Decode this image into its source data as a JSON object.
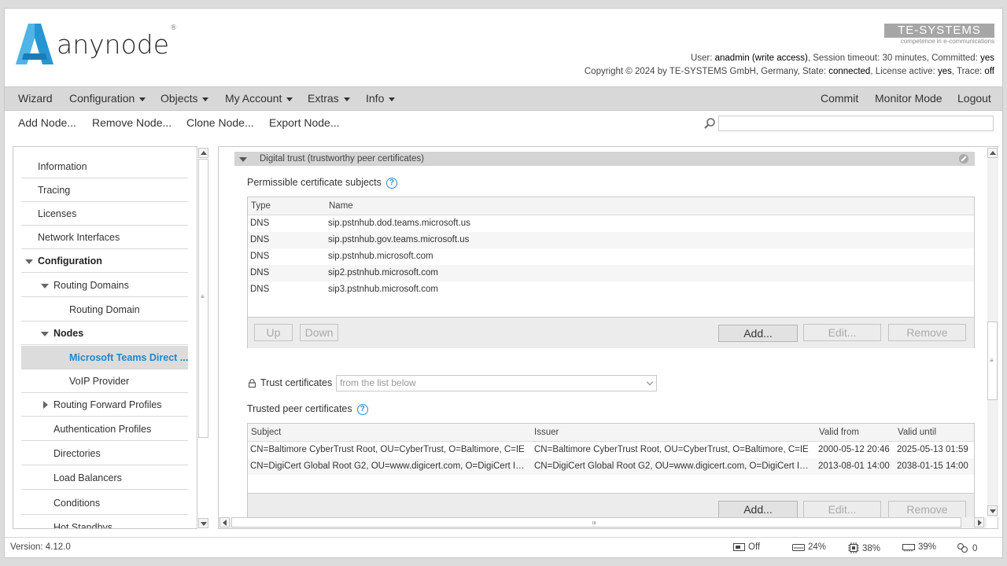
{
  "header": {
    "logo_text": "anynode",
    "logo_reg": "®",
    "brand_name": "TE-SYSTEMS",
    "brand_tagline": "competence in e-communications",
    "info_line1": {
      "user_label": "User: ",
      "user": "anadmin",
      "access": " (write access)",
      "session": ", Session timeout: 30 minutes, Committed: ",
      "committed": "yes"
    },
    "info_line2": {
      "copyright": "Copyright © 2024 by TE-SYSTEMS GmbH, Germany, State: ",
      "state": "connected",
      "license": ", License active: ",
      "license_val": "yes",
      "trace": ", Trace: ",
      "trace_val": "off"
    }
  },
  "menu": {
    "left": [
      {
        "label": "Wizard",
        "dropdown": false
      },
      {
        "label": "Configuration",
        "dropdown": true
      },
      {
        "label": "Objects",
        "dropdown": true
      },
      {
        "label": "My Account",
        "dropdown": true
      },
      {
        "label": "Extras",
        "dropdown": true
      },
      {
        "label": "Info",
        "dropdown": true
      }
    ],
    "right": [
      "Commit",
      "Monitor Mode",
      "Logout"
    ]
  },
  "toolbar": {
    "add_node": "Add Node...",
    "remove_node": "Remove Node...",
    "clone_node": "Clone Node...",
    "export_node": "Export Node...",
    "search_placeholder": ""
  },
  "sidebar": {
    "items": [
      {
        "label": "Information"
      },
      {
        "label": "Tracing"
      },
      {
        "label": "Licenses"
      },
      {
        "label": "Network Interfaces"
      },
      {
        "label": "Configuration"
      },
      {
        "label": "Routing Domains"
      },
      {
        "label": "Routing Domain"
      },
      {
        "label": "Nodes"
      },
      {
        "label": "Microsoft Teams Direct ..."
      },
      {
        "label": "VoIP Provider"
      },
      {
        "label": "Routing Forward Profiles"
      },
      {
        "label": "Authentication Profiles"
      },
      {
        "label": "Directories"
      },
      {
        "label": "Load Balancers"
      },
      {
        "label": "Conditions"
      },
      {
        "label": "Hot Standbys"
      }
    ]
  },
  "main": {
    "section_title": "Digital trust (trustworthy peer certificates)",
    "subjects_label": "Permissible certificate subjects",
    "subjects_table": {
      "headers": [
        "Type",
        "Name"
      ],
      "rows": [
        [
          "DNS",
          "sip.pstnhub.dod.teams.microsoft.us"
        ],
        [
          "DNS",
          "sip.pstnhub.gov.teams.microsoft.us"
        ],
        [
          "DNS",
          "sip.pstnhub.microsoft.com"
        ],
        [
          "DNS",
          "sip2.pstnhub.microsoft.com"
        ],
        [
          "DNS",
          "sip3.pstnhub.microsoft.com"
        ]
      ],
      "buttons": {
        "up": "Up",
        "down": "Down",
        "add": "Add...",
        "edit": "Edit...",
        "remove": "Remove"
      }
    },
    "trust_label": "Trust certificates",
    "trust_value": "from the list below",
    "trusted_label": "Trusted peer certificates",
    "certs_table": {
      "headers": [
        "Subject",
        "Issuer",
        "Valid from",
        "Valid until"
      ],
      "rows": [
        [
          "CN=Baltimore CyberTrust Root, OU=CyberTrust, O=Baltimore, C=IE",
          "CN=Baltimore CyberTrust Root, OU=CyberTrust, O=Baltimore, C=IE",
          "2000-05-12 20:46",
          "2025-05-13 01:59"
        ],
        [
          "CN=DigiCert Global Root G2, OU=www.digicert.com, O=DigiCert Inc, ...",
          "CN=DigiCert Global Root G2, OU=www.digicert.com, O=DigiCert Inc, ...",
          "2013-08-01 14:00",
          "2038-01-15 14:00"
        ]
      ],
      "buttons": {
        "add": "Add...",
        "edit": "Edit...",
        "remove": "Remove"
      }
    }
  },
  "status": {
    "version": "Version: 4.12.0",
    "monitor": "Off",
    "disk": "24%",
    "cpu": "38%",
    "memory": "39%",
    "connections": "0"
  },
  "colors": {
    "accent": "#1f87c9",
    "menubar": "#d8d8d8",
    "selected": "#dcdcdc"
  }
}
